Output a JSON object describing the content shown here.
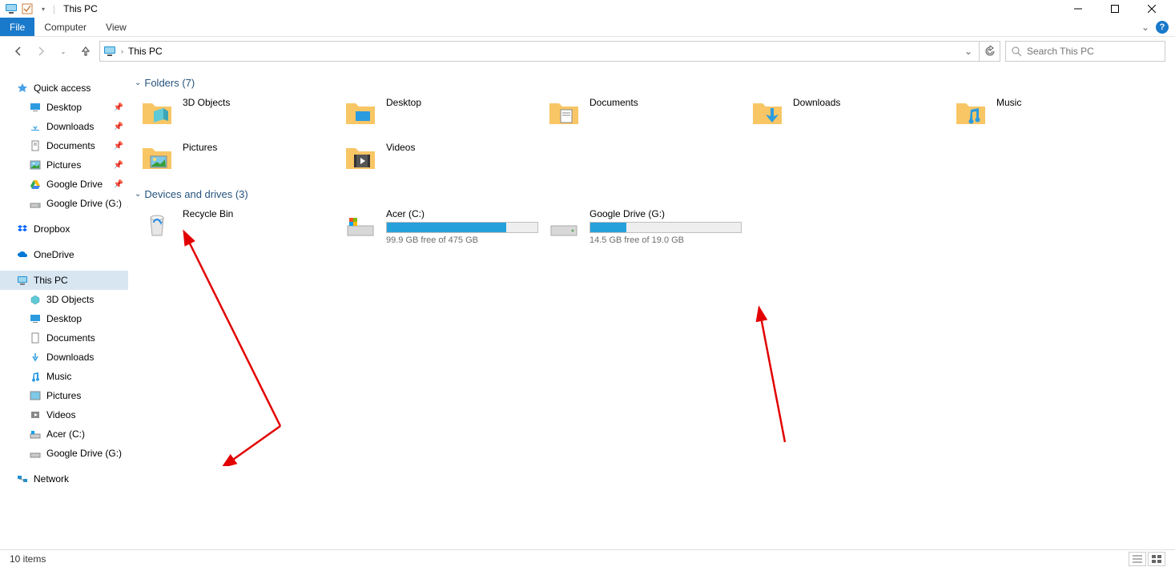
{
  "window": {
    "title": "This PC"
  },
  "ribbon": {
    "file": "File",
    "computer": "Computer",
    "view": "View"
  },
  "address": {
    "location": "This PC"
  },
  "search": {
    "placeholder": "Search This PC"
  },
  "tree": {
    "quick_access": "Quick access",
    "qa_items": [
      {
        "label": "Desktop",
        "pinned": true
      },
      {
        "label": "Downloads",
        "pinned": true
      },
      {
        "label": "Documents",
        "pinned": true
      },
      {
        "label": "Pictures",
        "pinned": true
      },
      {
        "label": "Google Drive",
        "pinned": true
      },
      {
        "label": "Google Drive (G:)",
        "pinned": true
      }
    ],
    "dropbox": "Dropbox",
    "onedrive": "OneDrive",
    "this_pc": "This PC",
    "pc_items": [
      {
        "label": "3D Objects"
      },
      {
        "label": "Desktop"
      },
      {
        "label": "Documents"
      },
      {
        "label": "Downloads"
      },
      {
        "label": "Music"
      },
      {
        "label": "Pictures"
      },
      {
        "label": "Videos"
      },
      {
        "label": "Acer (C:)"
      },
      {
        "label": "Google Drive (G:)"
      }
    ],
    "network": "Network"
  },
  "content": {
    "folders_header": "Folders (7)",
    "folders": [
      {
        "label": "3D Objects"
      },
      {
        "label": "Desktop"
      },
      {
        "label": "Documents"
      },
      {
        "label": "Downloads"
      },
      {
        "label": "Music"
      },
      {
        "label": "Pictures"
      },
      {
        "label": "Videos"
      }
    ],
    "drives_header": "Devices and drives (3)",
    "recycle": {
      "label": "Recycle Bin"
    },
    "drives": [
      {
        "name": "Acer (C:)",
        "free_text": "99.9 GB free of 475 GB",
        "fill_pct": 79
      },
      {
        "name": "Google Drive (G:)",
        "free_text": "14.5 GB free of 19.0 GB",
        "fill_pct": 24
      }
    ]
  },
  "status": {
    "count": "10 items"
  }
}
